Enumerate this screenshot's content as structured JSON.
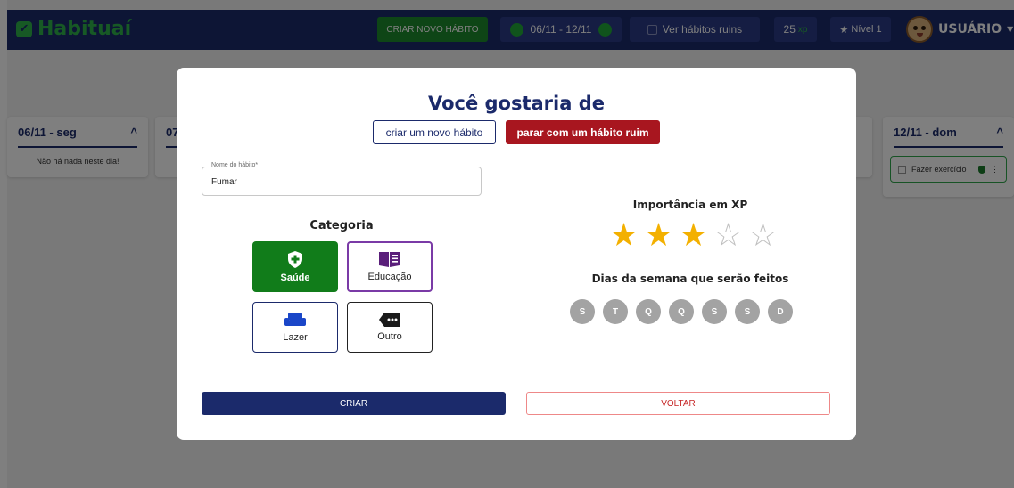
{
  "topbar": {
    "brand": "Habituaí",
    "create_label": "CRIAR NOVO HÁBITO",
    "week_range": "06/11 - 12/11",
    "bad_habits_label": "Ver hábitos ruins",
    "xp_value": "25",
    "xp_unit": "xp",
    "level_label": "Nível 1",
    "user_label": "USUÁRIO"
  },
  "days": [
    {
      "label": "06/11 - seg",
      "empty_text": "Não há nada neste dia!"
    },
    {
      "label": "07/"
    },
    {
      "label": "12/11 - dom",
      "habit": "Fazer exercício"
    }
  ],
  "modal": {
    "title": "Você gostaria de",
    "option_new": "criar um novo hábito",
    "option_bad": "parar com um hábito ruim",
    "name_field": {
      "label": "Nome do hábito*",
      "value": "Fumar"
    },
    "category_title": "Categoria",
    "categories": [
      {
        "label": "Saúde",
        "icon": "shield-plus-icon",
        "selected": true
      },
      {
        "label": "Educação",
        "icon": "book-icon",
        "selected": false
      },
      {
        "label": "Lazer",
        "icon": "sofa-icon",
        "selected": false
      },
      {
        "label": "Outro",
        "icon": "more-tag-icon",
        "selected": false
      }
    ],
    "xp_title": "Importância em XP",
    "xp_rating": 3,
    "xp_max": 5,
    "weekdays_title": "Dias da semana que serão feitos",
    "weekdays": [
      "S",
      "T",
      "Q",
      "Q",
      "S",
      "S",
      "D"
    ],
    "create_button": "CRIAR",
    "back_button": "VOLTAR"
  },
  "colors": {
    "navy": "#1b2a6b",
    "green": "#117c1a",
    "red": "#a8161f",
    "star": "#f3b000"
  }
}
